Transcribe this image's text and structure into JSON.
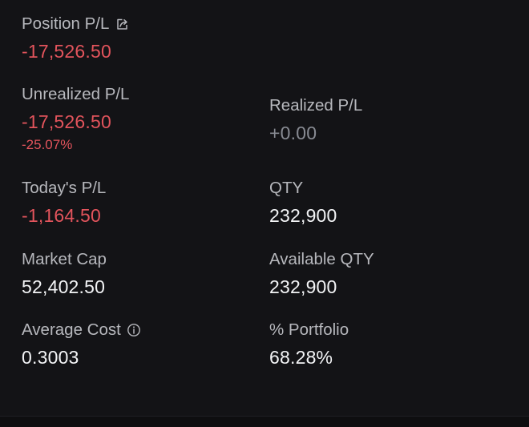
{
  "position_pl": {
    "label": "Position P/L",
    "icon": "share-icon",
    "value": "-17,526.50",
    "value_color": "#e2545c"
  },
  "unrealized_pl": {
    "label": "Unrealized P/L",
    "value": "-17,526.50",
    "percent": "-25.07%",
    "value_color": "#e2545c"
  },
  "realized_pl": {
    "label": "Realized P/L",
    "value": "+0.00",
    "value_color": "#888b93"
  },
  "todays_pl": {
    "label": "Today's P/L",
    "value": "-1,164.50",
    "value_color": "#e2545c"
  },
  "qty": {
    "label": "QTY",
    "value": "232,900"
  },
  "market_cap": {
    "label": "Market Cap",
    "value": "52,402.50"
  },
  "available_qty": {
    "label": "Available QTY",
    "value": "232,900"
  },
  "average_cost": {
    "label": "Average Cost",
    "icon": "info-icon",
    "value": "0.3003"
  },
  "portfolio_pct": {
    "label": "% Portfolio",
    "value": "68.28%"
  },
  "colors": {
    "background": "#131316",
    "label": "#b7b8bd",
    "negative": "#e2545c",
    "neutral": "#f3f4f6",
    "muted": "#888b93"
  }
}
